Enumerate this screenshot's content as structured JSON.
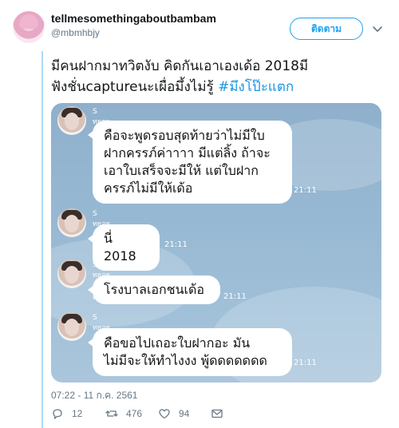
{
  "tweet": {
    "display_name": "tellmesomethingaboutbambam",
    "handle": "@mbmhbjy",
    "follow_label": "ติดตาม",
    "text_line1": "มีคนฝากมาทวิตงับ คิดกันเอาเองเด้อ 2018มี",
    "text_line2": "ฟังชั่นcaptureนะเผื่อมึ้งไม่รู้ ",
    "hashtag": "#มึงโป๊ะแตก",
    "timestamp": "07:22 - 11 ก.ค. 2561",
    "replies": "12",
    "retweets": "476",
    "likes": "94"
  },
  "chat": {
    "messages": [
      {
        "sender": "S ทยอยตอบค่ะ",
        "lines": [
          "คือจะพูดรอบสุดท้ายว่าไม่มีใบ",
          "ฝากครรภ์ค่าาาา มีแต่ลิ้ง ถ้าจะ",
          "เอาใบเสร็จจะมีให้ แต่ใบฝาก",
          "ครรภ์ไม่มีให้เด้อ"
        ],
        "time": "21:11"
      },
      {
        "sender": "S ทยอยตอบค่ะ",
        "lines": [
          "นี่ 2018"
        ],
        "time": "21:11"
      },
      {
        "sender": "S ทยอยตอบค่ะ",
        "lines": [
          "โรงบาลเอกชนเด้อ"
        ],
        "time": "21:11"
      },
      {
        "sender": "S ทยอยตอบค่ะ",
        "lines": [
          "คือขอไปเถอะใบฝากอะ มัน",
          "ไม่มีจะให้ทำไงงง พู้ดดดดดดด"
        ],
        "time": "21:11"
      }
    ]
  },
  "icons": {
    "reply": "reply-icon",
    "retweet": "retweet-icon",
    "like": "heart-icon",
    "message": "envelope-icon",
    "caret": "chevron-down-icon"
  },
  "colors": {
    "accent": "#1da1f2",
    "hashtag": "#1b95e0",
    "muted": "#657786",
    "thread_line": "#a9dbf5"
  }
}
